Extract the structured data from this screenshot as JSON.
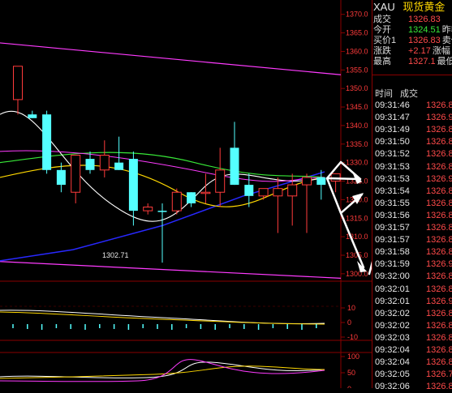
{
  "quote": {
    "symbol": "XAU",
    "name": "现货黄金",
    "rows": [
      {
        "label": "成交",
        "value": "1326.83",
        "color": "#ff4a4a"
      },
      {
        "label": "今开",
        "value": "1324.51",
        "extra": "昨收",
        "color": "#38e838"
      },
      {
        "label": "买价1",
        "value": "1326.83",
        "extra": "卖价",
        "color": "#ff4a4a"
      },
      {
        "label": "涨跌",
        "value": "+2.17",
        "extra": "涨幅",
        "color": "#ff4a4a"
      },
      {
        "label": "最高",
        "value": "1327.1",
        "extra": "最低",
        "color": "#ff4a4a"
      }
    ]
  },
  "trade_header": {
    "time": "时间",
    "price": "成交"
  },
  "trades": [
    {
      "time": "09:31:46",
      "price": "1326.8"
    },
    {
      "time": "09:31:47",
      "price": "1326.9"
    },
    {
      "time": "09:31:49",
      "price": "1326.8"
    },
    {
      "time": "09:31:50",
      "price": "1326.8"
    },
    {
      "time": "09:31:52",
      "price": "1326.8"
    },
    {
      "time": "09:31:53",
      "price": "1326.8"
    },
    {
      "time": "09:31:53",
      "price": "1326.9"
    },
    {
      "time": "09:31:54",
      "price": "1326.8"
    },
    {
      "time": "09:31:55",
      "price": "1326.8"
    },
    {
      "time": "09:31:56",
      "price": "1326.8"
    },
    {
      "time": "09:31:57",
      "price": "1326.8"
    },
    {
      "time": "09:31:57",
      "price": "1326.8"
    },
    {
      "time": "09:31:58",
      "price": "1326.8"
    },
    {
      "time": "09:31:59",
      "price": "1326.9"
    },
    {
      "time": "09:32:00",
      "price": "1326.8"
    },
    {
      "time": "09:32:01",
      "price": "1326.8"
    },
    {
      "time": "09:32:01",
      "price": "1326.9"
    },
    {
      "time": "09:32:02",
      "price": "1326.8"
    },
    {
      "time": "09:32:02",
      "price": "1326.8"
    },
    {
      "time": "09:32:03",
      "price": "1326.8"
    },
    {
      "time": "09:32:04",
      "price": "1326.8"
    },
    {
      "time": "09:32:04",
      "price": "1326.8"
    },
    {
      "time": "09:32:05",
      "price": "1326.7"
    },
    {
      "time": "09:32:06",
      "price": "1326.8"
    }
  ],
  "chart_data": {
    "type": "candlestick",
    "y_ticks": [
      "1370.0",
      "1365.0",
      "1360.0",
      "1355.0",
      "1350.0",
      "1345.0",
      "1340.0",
      "1335.0",
      "1330.0",
      "1325.0",
      "1320.0",
      "1315.0",
      "1310.0",
      "1305.0",
      "1300.0"
    ],
    "ylim": [
      1298,
      1373
    ],
    "annotation": "1302.71",
    "candles": [
      {
        "o": 1347,
        "h": 1351,
        "l": 1343,
        "c": 1356,
        "dir": "up"
      },
      {
        "o": 1343,
        "h": 1344,
        "l": 1342,
        "c": 1342,
        "dir": "down"
      },
      {
        "o": 1343,
        "h": 1344,
        "l": 1327,
        "c": 1328,
        "dir": "down"
      },
      {
        "o": 1328,
        "h": 1330,
        "l": 1322,
        "c": 1324,
        "dir": "down"
      },
      {
        "o": 1322,
        "h": 1332,
        "l": 1319,
        "c": 1332,
        "dir": "up"
      },
      {
        "o": 1331,
        "h": 1333,
        "l": 1327,
        "c": 1328,
        "dir": "down"
      },
      {
        "o": 1328,
        "h": 1336,
        "l": 1326,
        "c": 1332,
        "dir": "up"
      },
      {
        "o": 1330,
        "h": 1337,
        "l": 1328,
        "c": 1328,
        "dir": "down"
      },
      {
        "o": 1331,
        "h": 1333,
        "l": 1313,
        "c": 1317,
        "dir": "down"
      },
      {
        "o": 1317,
        "h": 1319,
        "l": 1316,
        "c": 1318,
        "dir": "up"
      },
      {
        "o": 1317,
        "h": 1319,
        "l": 1303,
        "c": 1317,
        "dir": "down"
      },
      {
        "o": 1317,
        "h": 1323,
        "l": 1316,
        "c": 1322,
        "dir": "up"
      },
      {
        "o": 1319,
        "h": 1322,
        "l": 1318,
        "c": 1322,
        "dir": "down"
      },
      {
        "o": 1322,
        "h": 1327,
        "l": 1319,
        "c": 1322,
        "dir": "up"
      },
      {
        "o": 1322,
        "h": 1334,
        "l": 1318,
        "c": 1328,
        "dir": "up"
      },
      {
        "o": 1334,
        "h": 1341,
        "l": 1324,
        "c": 1324,
        "dir": "down"
      },
      {
        "o": 1324,
        "h": 1327,
        "l": 1318,
        "c": 1321,
        "dir": "down"
      },
      {
        "o": 1321,
        "h": 1323,
        "l": 1320,
        "c": 1323,
        "dir": "up"
      },
      {
        "o": 1323,
        "h": 1326,
        "l": 1311,
        "c": 1321,
        "dir": "up"
      },
      {
        "o": 1321,
        "h": 1327,
        "l": 1313,
        "c": 1324,
        "dir": "up"
      },
      {
        "o": 1324,
        "h": 1327,
        "l": 1311,
        "c": 1326,
        "dir": "up"
      },
      {
        "o": 1324,
        "h": 1328,
        "l": 1320,
        "c": 1326,
        "dir": "down"
      },
      {
        "o": 1325,
        "h": 1327,
        "l": 1322,
        "c": 1327,
        "dir": "up"
      }
    ],
    "macd_ticks": [
      "10",
      "0",
      "-10"
    ],
    "kdj_ticks": [
      "100",
      "50",
      "0"
    ]
  },
  "colors": {
    "background": "#000000",
    "up": "#ff3b3b",
    "down": "#54ffff",
    "axis": "#8a0000",
    "ma1": "#ffffff",
    "ma2": "#ffd800",
    "ma3": "#ff3bff",
    "ma4": "#38e838",
    "trend_line": "#2828ff"
  }
}
